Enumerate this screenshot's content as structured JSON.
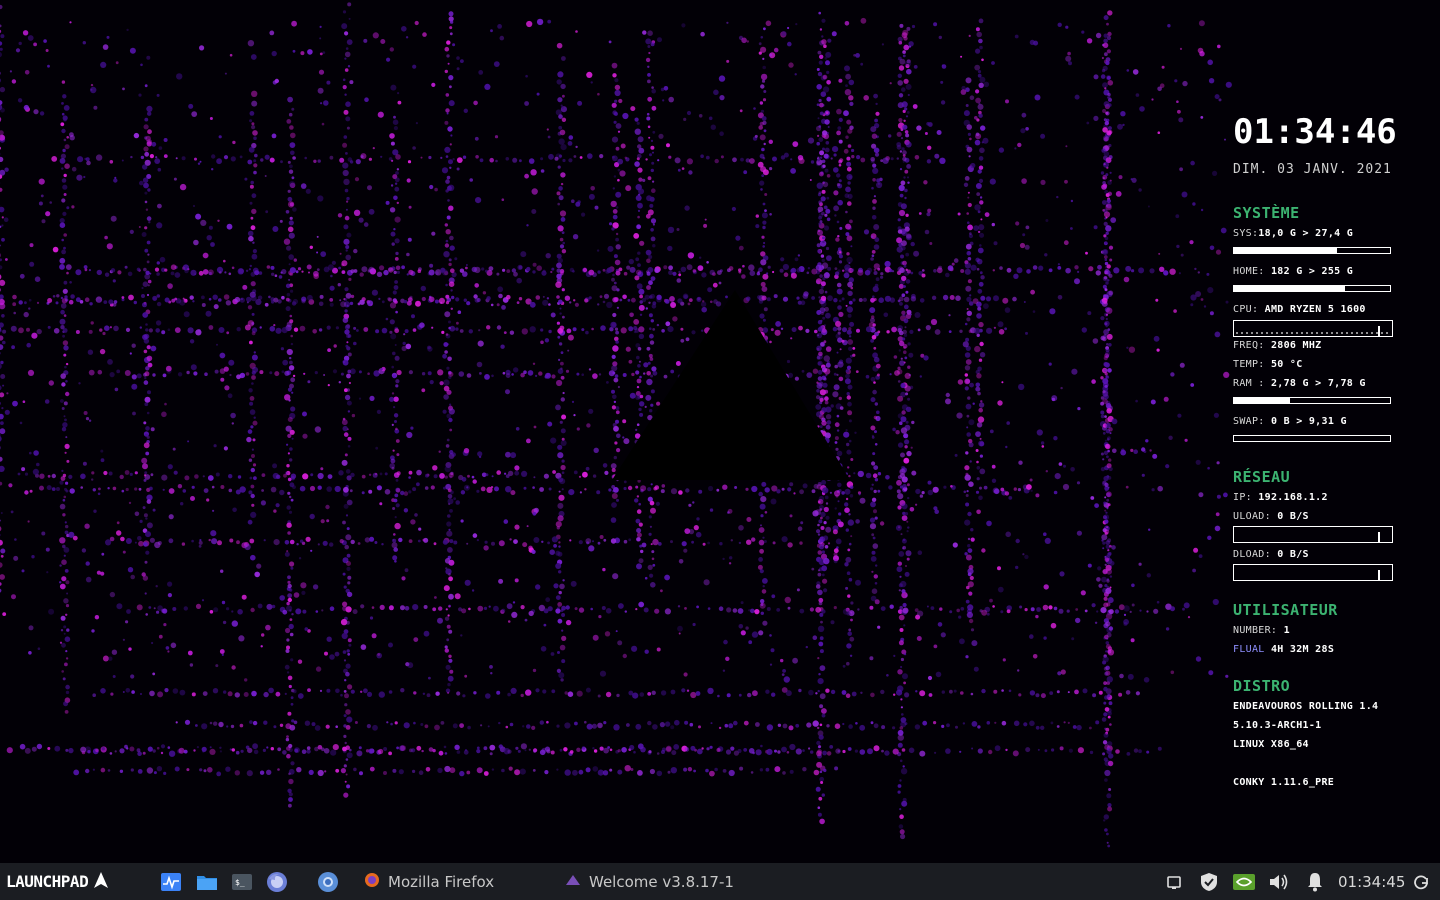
{
  "desktop": {
    "wallpaper": "purple-dot-grid-abstract",
    "accent": "#8a2be2"
  },
  "conky": {
    "clock": "01:34:46",
    "date": "DIM. 03 JANV. 2021",
    "systeme": {
      "heading": "SYSTÈME",
      "sys_label": "SYS:",
      "sys_value": "18,0 G > 27,4 G",
      "sys_usage": 0.66,
      "home_label": "HOME:",
      "home_value": "182 G > 255 G",
      "home_usage": 0.71,
      "cpu_label": "CPU:",
      "cpu_value": "AMD RYZEN 5 1600",
      "freq_label": "FREQ:",
      "freq_value": "2806 MHZ",
      "temp_label": "TEMP:",
      "temp_value": "50 °C",
      "ram_label": "RAM :",
      "ram_value": "2,78 G > 7,78 G",
      "ram_usage": 0.36,
      "swap_label": "SWAP:",
      "swap_value": "0 B > 9,31 G",
      "swap_usage": 0.0
    },
    "reseau": {
      "heading": "RÉSEAU",
      "ip_label": "IP:",
      "ip_value": "192.168.1.2",
      "upload_label": "ULOAD:",
      "upload_value": "0 B/S",
      "download_label": "DLOAD:",
      "download_value": "0 B/S"
    },
    "utilisateur": {
      "heading": "UTILISATEUR",
      "number_label": "NUMBER:",
      "number_value": "1",
      "user_name": "FLUAL",
      "uptime": "4H 32M 28S"
    },
    "distro": {
      "heading": "DISTRO",
      "name": "ENDEAVOUROS ROLLING 1.4",
      "kernel": "5.10.3-ARCH1-1",
      "arch": "LINUX X86_64",
      "conky_version": "CONKY 1.11.6_PRE"
    }
  },
  "taskbar": {
    "launcher_label": "LAUNCHPAD",
    "pinned": [
      {
        "name": "system-monitor-icon",
        "color": "#3b82f6"
      },
      {
        "name": "folder-icon",
        "color": "#2f8ee6"
      },
      {
        "name": "terminal-icon",
        "color": "#4a5560"
      },
      {
        "name": "firefox-icon",
        "color": "#6b7fd7"
      },
      {
        "name": "chromium-icon",
        "color": "#5a8fd8"
      }
    ],
    "tasks": [
      {
        "label": "Mozilla Firefox",
        "icon": "firefox-icon"
      },
      {
        "label": "Welcome v3.8.17-1",
        "icon": "endeavouros-icon"
      }
    ],
    "tray": {
      "time": "01:34:45",
      "icons": [
        "display-icon",
        "shield-icon",
        "nvidia-icon",
        "volume-icon",
        "bell-icon",
        "updates-icon"
      ]
    }
  }
}
